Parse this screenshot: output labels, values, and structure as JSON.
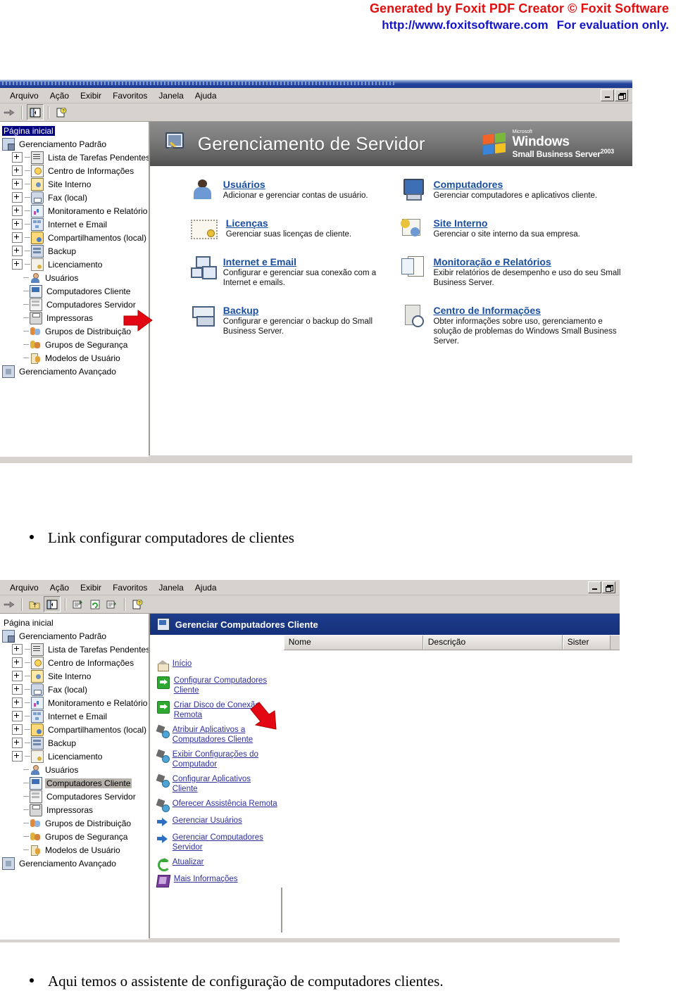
{
  "watermark": {
    "line1": "Generated by Foxit PDF Creator © Foxit Software",
    "url": "http://www.foxitsoftware.com",
    "eval": "For evaluation only."
  },
  "menubar": {
    "items": [
      "Arquivo",
      "Ação",
      "Exibir",
      "Favoritos",
      "Janela",
      "Ajuda"
    ]
  },
  "window1": {
    "banner": {
      "title": "Gerenciamento de Servidor",
      "brand_microsoft": "Microsoft",
      "brand_windows": "Windows",
      "brand_product": "Small Business Server",
      "brand_year": "2003"
    },
    "tree": [
      {
        "label": "Página inicial",
        "icon": "home-page-icon",
        "expander": false,
        "indent": 0,
        "state": "selected-dark"
      },
      {
        "label": "Gerenciamento Padrão",
        "icon": "management-icon",
        "expander": false,
        "indent": 0,
        "state": ""
      },
      {
        "label": "Lista de Tarefas Pendentes",
        "icon": "tasks-icon",
        "expander": true,
        "indent": 1,
        "state": ""
      },
      {
        "label": "Centro de Informações",
        "icon": "info-icon",
        "expander": true,
        "indent": 1,
        "state": ""
      },
      {
        "label": "Site Interno",
        "icon": "site-icon",
        "expander": true,
        "indent": 1,
        "state": ""
      },
      {
        "label": "Fax (local)",
        "icon": "fax-icon",
        "expander": true,
        "indent": 1,
        "state": ""
      },
      {
        "label": "Monitoramento e Relatório",
        "icon": "monitor-icon",
        "expander": true,
        "indent": 1,
        "state": ""
      },
      {
        "label": "Internet e Email",
        "icon": "internet-icon",
        "expander": true,
        "indent": 1,
        "state": ""
      },
      {
        "label": "Compartilhamentos (local)",
        "icon": "share-icon",
        "expander": true,
        "indent": 1,
        "state": ""
      },
      {
        "label": "Backup",
        "icon": "backup-icon",
        "expander": true,
        "indent": 1,
        "state": ""
      },
      {
        "label": "Licenciamento",
        "icon": "license-icon",
        "expander": true,
        "indent": 1,
        "state": ""
      },
      {
        "label": "Usuários",
        "icon": "user-icon",
        "expander": false,
        "indent": 1,
        "state": ""
      },
      {
        "label": "Computadores Cliente",
        "icon": "client-computer-icon",
        "expander": false,
        "indent": 1,
        "state": ""
      },
      {
        "label": "Computadores Servidor",
        "icon": "server-computer-icon",
        "expander": false,
        "indent": 1,
        "state": ""
      },
      {
        "label": "Impressoras",
        "icon": "printer-icon",
        "expander": false,
        "indent": 1,
        "state": ""
      },
      {
        "label": "Grupos de Distribuição",
        "icon": "distribution-group-icon",
        "expander": false,
        "indent": 1,
        "state": ""
      },
      {
        "label": "Grupos de Segurança",
        "icon": "security-group-icon",
        "expander": false,
        "indent": 1,
        "state": ""
      },
      {
        "label": "Modelos de Usuário",
        "icon": "user-template-icon",
        "expander": false,
        "indent": 1,
        "state": ""
      },
      {
        "label": "Gerenciamento Avançado",
        "icon": "advanced-icon",
        "expander": false,
        "indent": 0,
        "state": ""
      }
    ],
    "cards_left": [
      {
        "title": "Usuários",
        "desc": "Adicionar e gerenciar contas de usuário.",
        "icon": "users-icon"
      },
      {
        "title": "Licenças",
        "desc": "Gerenciar suas licenças de cliente.",
        "icon": "license-card-icon"
      },
      {
        "title": "Internet e Email",
        "desc": "Configurar e gerenciar sua conexão com a Internet e emails.",
        "icon": "internet-card-icon"
      },
      {
        "title": "Backup",
        "desc": "Configurar e gerenciar o backup do Small Business Server.",
        "icon": "backup-card-icon"
      }
    ],
    "cards_right": [
      {
        "title": "Computadores",
        "desc": "Gerenciar computadores e aplicativos cliente.",
        "icon": "computers-card-icon"
      },
      {
        "title": "Site Interno",
        "desc": "Gerenciar o site interno da sua empresa.",
        "icon": "internal-site-card-icon"
      },
      {
        "title": "Monitoração e Relatórios",
        "desc": "Exibir relatórios de desempenho e uso do seu Small Business Server.",
        "icon": "monitoring-card-icon"
      },
      {
        "title": "Centro de Informações",
        "desc": "Obter informações sobre uso, gerenciamento e solução de problemas do Windows Small Business Server.",
        "icon": "info-center-card-icon"
      }
    ]
  },
  "caption1": "Link configurar computadores de clientes",
  "window2": {
    "header_title": "Gerenciar Computadores Cliente",
    "columns": [
      "Nome",
      "Descrição",
      "Sister"
    ],
    "tree": [
      {
        "label": "Página inicial",
        "icon": "home-page-icon",
        "expander": false,
        "indent": 0,
        "state": ""
      },
      {
        "label": "Gerenciamento Padrão",
        "icon": "management-icon",
        "expander": false,
        "indent": 0,
        "state": ""
      },
      {
        "label": "Lista de Tarefas Pendentes",
        "icon": "tasks-icon",
        "expander": true,
        "indent": 1,
        "state": ""
      },
      {
        "label": "Centro de Informações",
        "icon": "info-icon",
        "expander": true,
        "indent": 1,
        "state": ""
      },
      {
        "label": "Site Interno",
        "icon": "site-icon",
        "expander": true,
        "indent": 1,
        "state": ""
      },
      {
        "label": "Fax (local)",
        "icon": "fax-icon",
        "expander": true,
        "indent": 1,
        "state": ""
      },
      {
        "label": "Monitoramento e Relatório",
        "icon": "monitor-icon",
        "expander": true,
        "indent": 1,
        "state": ""
      },
      {
        "label": "Internet e Email",
        "icon": "internet-icon",
        "expander": true,
        "indent": 1,
        "state": ""
      },
      {
        "label": "Compartilhamentos (local)",
        "icon": "share-icon",
        "expander": true,
        "indent": 1,
        "state": ""
      },
      {
        "label": "Backup",
        "icon": "backup-icon",
        "expander": true,
        "indent": 1,
        "state": ""
      },
      {
        "label": "Licenciamento",
        "icon": "license-icon",
        "expander": true,
        "indent": 1,
        "state": ""
      },
      {
        "label": "Usuários",
        "icon": "user-icon",
        "expander": false,
        "indent": 1,
        "state": ""
      },
      {
        "label": "Computadores Cliente",
        "icon": "client-computer-icon",
        "expander": false,
        "indent": 1,
        "state": "selected-grey"
      },
      {
        "label": "Computadores Servidor",
        "icon": "server-computer-icon",
        "expander": false,
        "indent": 1,
        "state": ""
      },
      {
        "label": "Impressoras",
        "icon": "printer-icon",
        "expander": false,
        "indent": 1,
        "state": ""
      },
      {
        "label": "Grupos de Distribuição",
        "icon": "distribution-group-icon",
        "expander": false,
        "indent": 1,
        "state": ""
      },
      {
        "label": "Grupos de Segurança",
        "icon": "security-group-icon",
        "expander": false,
        "indent": 1,
        "state": ""
      },
      {
        "label": "Modelos de Usuário",
        "icon": "user-template-icon",
        "expander": false,
        "indent": 1,
        "state": ""
      },
      {
        "label": "Gerenciamento Avançado",
        "icon": "advanced-icon",
        "expander": false,
        "indent": 0,
        "state": ""
      }
    ],
    "tasks": [
      {
        "label": "Início",
        "icon": "home-icon"
      },
      {
        "label": "Configurar Computadores Cliente",
        "icon": "green-arrow-icon"
      },
      {
        "label": "Criar Disco de Conexão Remota",
        "icon": "green-arrow-icon"
      },
      {
        "label": "Atribuir Aplicativos a Computadores Cliente",
        "icon": "gear-icon"
      },
      {
        "label": "Exibir Configurações do Computador",
        "icon": "gear-icon"
      },
      {
        "label": "Configurar Aplicativos Cliente",
        "icon": "gear-icon"
      },
      {
        "label": "Oferecer Assistência Remota",
        "icon": "gear-icon"
      },
      {
        "label": "Gerenciar Usuários",
        "icon": "blue-arrow-icon"
      },
      {
        "label": "Gerenciar Computadores Servidor",
        "icon": "blue-arrow-icon"
      },
      {
        "label": "Atualizar",
        "icon": "refresh-icon"
      },
      {
        "label": "Mais Informações",
        "icon": "book-icon"
      }
    ]
  },
  "caption2": "Aqui temos o assistente de configuração de computadores clientes."
}
